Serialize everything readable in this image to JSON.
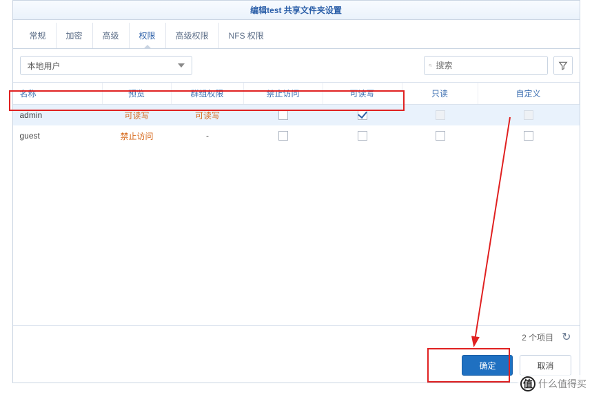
{
  "title": "编辑test 共享文件夹设置",
  "tabs": [
    "常规",
    "加密",
    "高级",
    "权限",
    "高级权限",
    "NFS 权限"
  ],
  "activeTab": 3,
  "dropdown": {
    "value": "本地用户"
  },
  "search": {
    "placeholder": "搜索"
  },
  "columns": {
    "name": "名称",
    "preview": "预览",
    "group": "群组权限",
    "deny": "禁止访问",
    "rw": "可读写",
    "ro": "只读",
    "custom": "自定义"
  },
  "rows": [
    {
      "name": "admin",
      "preview": "可读写",
      "group": "可读写",
      "deny": false,
      "rw": true,
      "ro_disabled": true,
      "custom_disabled": true,
      "selected": true
    },
    {
      "name": "guest",
      "preview": "禁止访问",
      "group": "-",
      "deny": false,
      "rw": false,
      "ro_disabled": false,
      "custom_disabled": false,
      "selected": false
    }
  ],
  "footer": {
    "count": "2 个项目"
  },
  "buttons": {
    "ok": "确定",
    "cancel": "取消"
  },
  "watermark": "什么值得买"
}
